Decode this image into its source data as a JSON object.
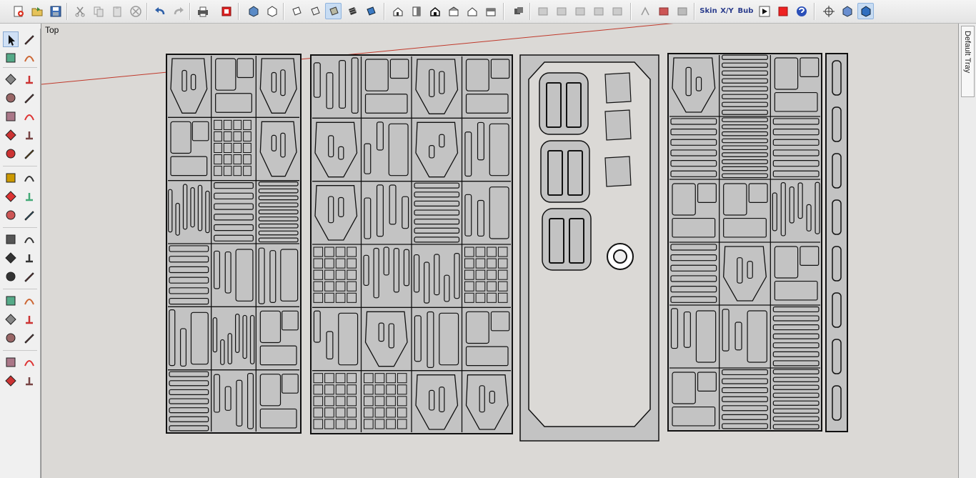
{
  "toolbar": {
    "skin_label": "Skin",
    "xy_label": "X/Y",
    "bub_label": "Bub",
    "icons": [
      "new-file",
      "open-folder",
      "save",
      "cut",
      "copy",
      "paste",
      "erase",
      "undo",
      "redo",
      "print",
      "model-info",
      "iso-view",
      "box-view",
      "face-style-a",
      "face-style-b",
      "shaded",
      "textured",
      "monochrome",
      "house-iso",
      "house-side",
      "house-front",
      "house-top",
      "house-left",
      "house-right",
      "components",
      "layers-a",
      "layers-b",
      "layers-c",
      "layers-d",
      "layers-e",
      "warehouse",
      "extension-a",
      "extension-b",
      "skin",
      "xy",
      "bubble",
      "play",
      "stop",
      "help",
      "position-camera",
      "section",
      "walk-view"
    ]
  },
  "left_tools": [
    "select",
    "component",
    "paint-bucket",
    "eraser",
    "pencil",
    "freehand",
    "rectangle",
    "rotated-rectangle",
    "circle",
    "polygon",
    "arc",
    "pie",
    "two-point-arc",
    "three-point-arc",
    "move",
    "push-pull",
    "rotate",
    "follow-me",
    "scale",
    "offset",
    "tape-measure",
    "text",
    "protractor",
    "dimension",
    "axes",
    "3d-text",
    "orbit",
    "pan",
    "zoom",
    "zoom-window",
    "zoom-extents",
    "previous",
    "position-camera",
    "look-around",
    "walk",
    "section-plane"
  ],
  "viewport": {
    "view_name": "Top",
    "colors": {
      "background": "#dbd9d6",
      "panel_fill": "#c3c3c3",
      "stroke": "#111111",
      "axis": "#c0392b"
    }
  },
  "tray": {
    "label": "Default Tray"
  }
}
